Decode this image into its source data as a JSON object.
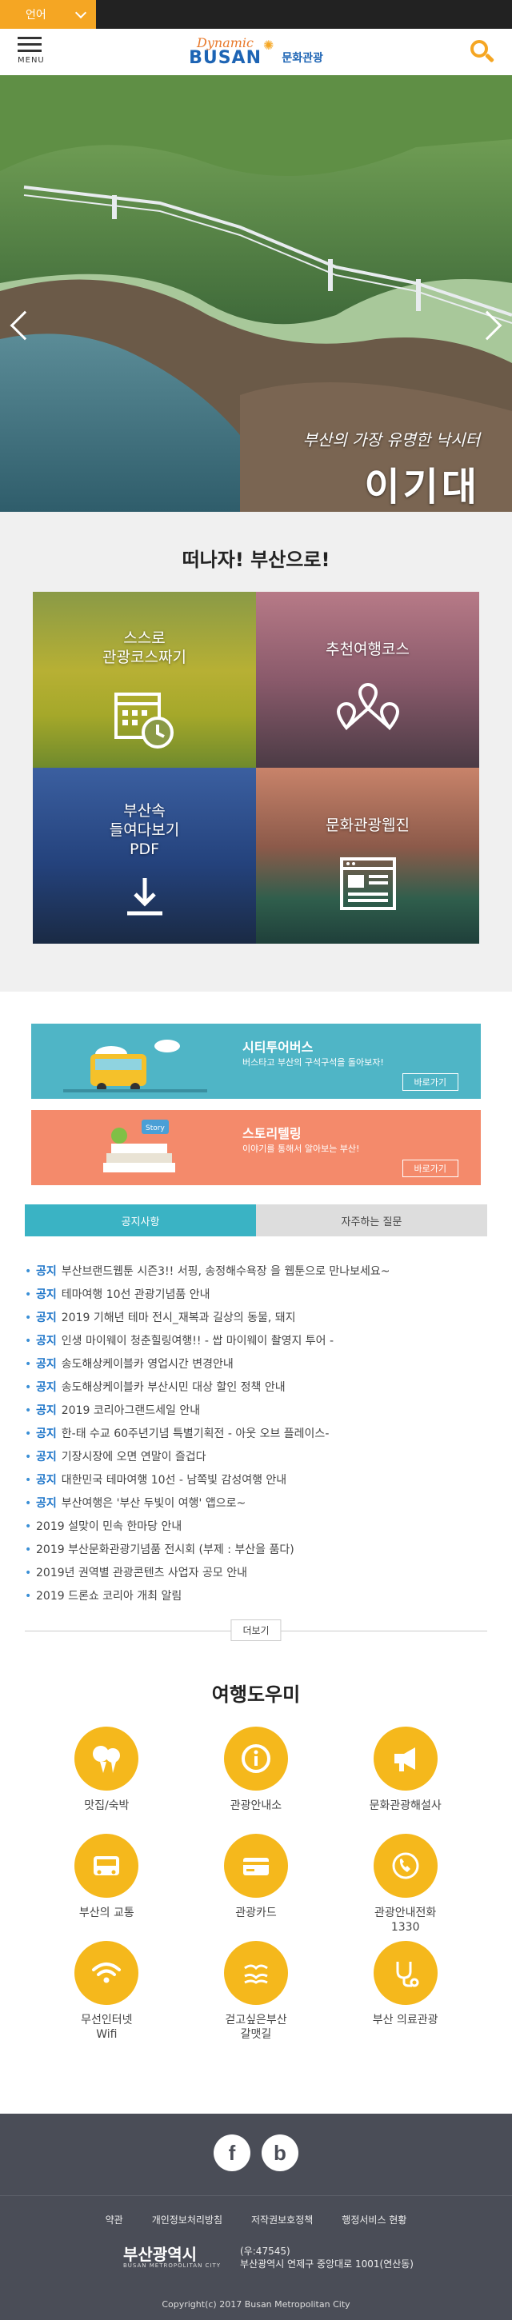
{
  "lang": {
    "label": "언어"
  },
  "header": {
    "menu_label": "MENU",
    "logo_dynamic": "Dynamic",
    "logo_busan": "BUSAN",
    "logo_sub": "문화관광"
  },
  "hero": {
    "subtitle": "부산의 가장 유명한 낙시터",
    "title": "이기대"
  },
  "letsgo": {
    "title": "떠나자! 부산으로!",
    "tiles": [
      {
        "label": "스스로\n관광코스짜기",
        "icon": "calendar-clock-icon"
      },
      {
        "label": "추천여행코스",
        "icon": "map-pins-icon"
      },
      {
        "label": "부산속\n들여다보기\nPDF",
        "icon": "download-icon"
      },
      {
        "label": "문화관광웹진",
        "icon": "webzine-icon"
      }
    ]
  },
  "banners": [
    {
      "title": "시티투어버스",
      "desc": "버스타고 부산의 구석구석을 돌아보자!",
      "more": "바로가기",
      "color": "#4fb5c6"
    },
    {
      "title": "스토리텔링",
      "desc": "이야기를 통해서 알아보는 부산!",
      "more": "바로가기",
      "color": "#f48a6b"
    }
  ],
  "tabs": {
    "notice": "공지사항",
    "faq": "자주하는 질문"
  },
  "notices": [
    {
      "tag": "공지",
      "text": "부산브랜드웹툰 시즌3!! 서핑, 송정해수욕장 을 웹툰으로 만나보세요~"
    },
    {
      "tag": "공지",
      "text": "테마여행 10선 관광기념품 안내"
    },
    {
      "tag": "공지",
      "text": "2019 기해년 테마 전시_재복과 길상의 동물, 돼지"
    },
    {
      "tag": "공지",
      "text": "인생 마이웨이 청춘힐링여행!! - 쌉 마이웨이 촬영지 투어 -"
    },
    {
      "tag": "공지",
      "text": "송도해상케이블카 영업시간 변경안내"
    },
    {
      "tag": "공지",
      "text": "송도해상케이블카 부산시민 대상 할인 정책 안내"
    },
    {
      "tag": "공지",
      "text": "2019 코리아그랜드세일 안내"
    },
    {
      "tag": "공지",
      "text": "한-태 수교 60주년기념 특별기획전 - 아웃 오브 플레이스-"
    },
    {
      "tag": "공지",
      "text": "기장시장에 오면 연말이 즐겁다"
    },
    {
      "tag": "공지",
      "text": "대한민국 테마여행 10선 - 남쪽빛 감성여행 안내"
    },
    {
      "tag": "공지",
      "text": "부산여행은 '부산 두빛이 여행' 앱으로~"
    },
    {
      "tag": "",
      "text": "2019 설맞이 민속 한마당 안내"
    },
    {
      "tag": "",
      "text": "2019 부산문화관광기념품 전시회 (부제 : 부산을 품다)"
    },
    {
      "tag": "",
      "text": "2019년 권역별 관광콘텐츠 사업자 공모 안내"
    },
    {
      "tag": "",
      "text": "2019 드론쇼 코리아 개최 알림"
    }
  ],
  "more_label": "더보기",
  "helper": {
    "title": "여행도우미",
    "items": [
      {
        "label": "맛집/숙박",
        "icon": "food-icon"
      },
      {
        "label": "관광안내소",
        "icon": "info-icon"
      },
      {
        "label": "문화관광해설사",
        "icon": "megaphone-icon"
      },
      {
        "label": "부산의 교통",
        "icon": "bus-icon"
      },
      {
        "label": "관광카드",
        "icon": "card-icon"
      },
      {
        "label": "관광안내전화\n1330",
        "icon": "phone-icon"
      },
      {
        "label": "무선인터넷\nWifi",
        "icon": "wifi-icon"
      },
      {
        "label": "걷고싶은부산\n갈맷길",
        "icon": "seagull-icon"
      },
      {
        "label": "부산 의료관광",
        "icon": "stethoscope-icon"
      }
    ]
  },
  "footer": {
    "social": [
      "f",
      "b"
    ],
    "links": [
      "약관",
      "개인정보처리방침",
      "저작권보호정책",
      "행정서비스 현황"
    ],
    "city_name": "부산광역시",
    "city_en": "BUSAN METROPOLITAN CITY",
    "zip": "(우:47545)",
    "address": "부산광역시 연제구 중앙대로 1001(연산동)",
    "copyright": "Copyright(c) 2017 Busan Metropolitan City"
  }
}
